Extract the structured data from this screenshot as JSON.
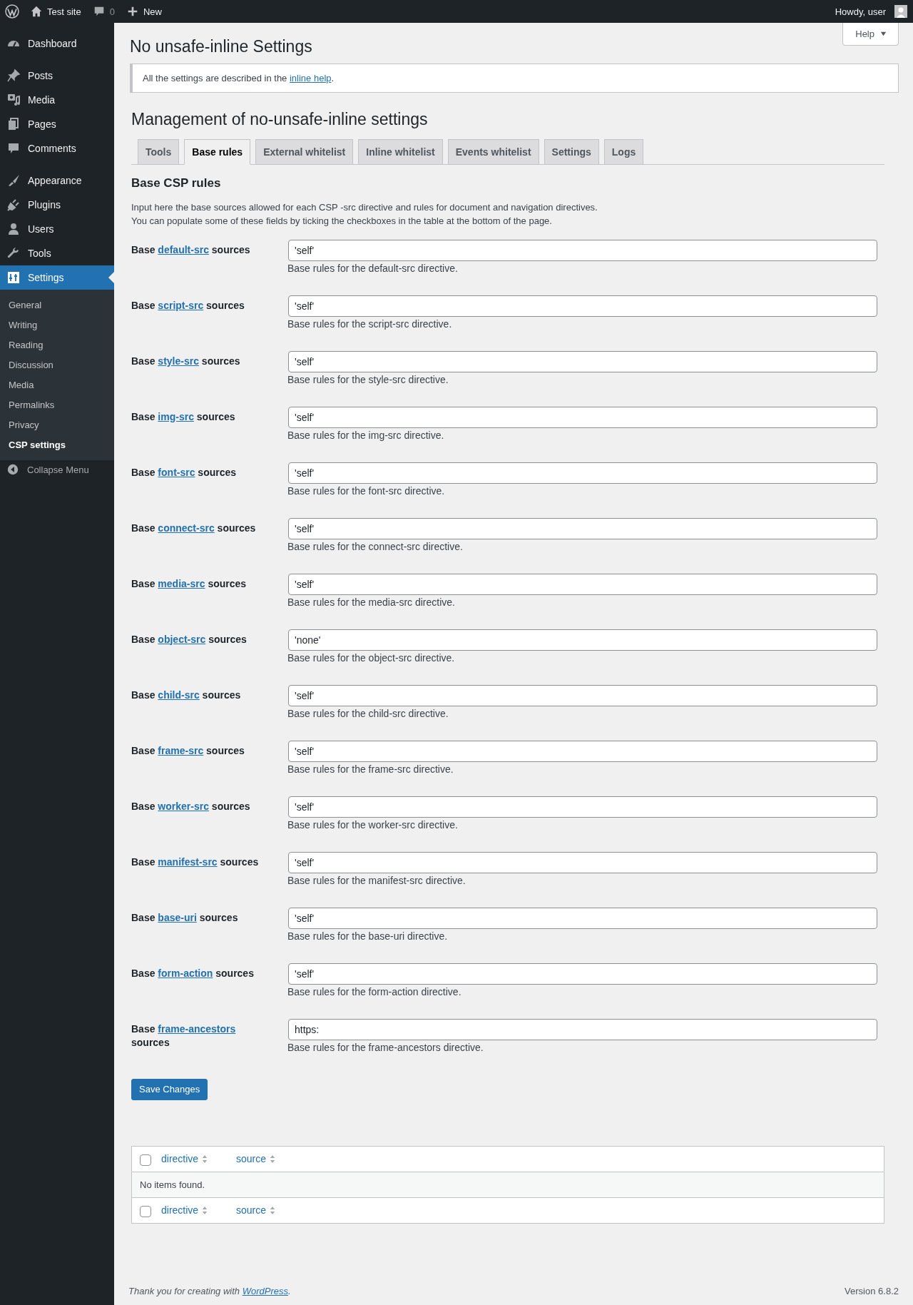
{
  "admin_bar": {
    "site": "Test site",
    "comments": "0",
    "new": "New",
    "greeting": "Howdy, user"
  },
  "menu": [
    {
      "items": [
        {
          "label": "Dashboard",
          "selected": false
        }
      ]
    },
    {
      "items": [
        {
          "label": "Posts",
          "selected": false
        },
        {
          "label": "Media",
          "selected": false
        },
        {
          "label": "Pages",
          "selected": false
        },
        {
          "label": "Comments",
          "selected": false
        }
      ]
    },
    {
      "items": [
        {
          "label": "Appearance",
          "selected": false
        },
        {
          "label": "Plugins",
          "selected": false
        },
        {
          "label": "Users",
          "selected": false
        },
        {
          "label": "Tools",
          "selected": false
        },
        {
          "label": "Settings",
          "selected": true,
          "submenu": [
            {
              "label": "General",
              "selected": false
            },
            {
              "label": "Writing",
              "selected": false
            },
            {
              "label": "Reading",
              "selected": false
            },
            {
              "label": "Discussion",
              "selected": false
            },
            {
              "label": "Media",
              "selected": false
            },
            {
              "label": "Permalinks",
              "selected": false
            },
            {
              "label": "Privacy",
              "selected": false
            },
            {
              "label": "CSP settings",
              "selected": true
            }
          ]
        }
      ]
    }
  ],
  "collapse_menu": "Collapse Menu",
  "help_button": "Help",
  "page_title": "No unsafe-inline Settings",
  "notice": {
    "text": "All the settings are described in the",
    "link": "inline help",
    "after": "."
  },
  "section_title": "Management of no-unsafe-inline settings",
  "tabs": [
    {
      "label": "Tools",
      "selected": false
    },
    {
      "label": "Base rules",
      "selected": true
    },
    {
      "label": "External whitelist",
      "selected": false
    },
    {
      "label": "Inline whitelist",
      "selected": false
    },
    {
      "label": "Events whitelist",
      "selected": false
    },
    {
      "label": "Settings",
      "selected": false
    },
    {
      "label": "Logs",
      "selected": false
    }
  ],
  "subsection_title": "Base CSP rules",
  "intro": [
    "Input here the base sources allowed for each CSP -src directive and rules for document and navigation directives.",
    "You can populate some of these fields by ticking the checkboxes in the table at the bottom of the page."
  ],
  "fields": [
    {
      "before": "Base",
      "link": "default-src",
      "after": "sources",
      "value": "'self'",
      "description": "Base rules for the default-src directive."
    },
    {
      "before": "Base",
      "link": "script-src",
      "after": "sources",
      "value": "'self'",
      "description": "Base rules for the script-src directive."
    },
    {
      "before": "Base",
      "link": "style-src",
      "after": "sources",
      "value": "'self'",
      "description": "Base rules for the style-src directive."
    },
    {
      "before": "Base",
      "link": "img-src",
      "after": "sources",
      "value": "'self'",
      "description": "Base rules for the img-src directive."
    },
    {
      "before": "Base",
      "link": "font-src",
      "after": "sources",
      "value": "'self'",
      "description": "Base rules for the font-src directive."
    },
    {
      "before": "Base",
      "link": "connect-src",
      "after": "sources",
      "value": "'self'",
      "description": "Base rules for the connect-src directive."
    },
    {
      "before": "Base",
      "link": "media-src",
      "after": "sources",
      "value": "'self'",
      "description": "Base rules for the media-src directive."
    },
    {
      "before": "Base",
      "link": "object-src",
      "after": "sources",
      "value": "'none'",
      "description": "Base rules for the object-src directive."
    },
    {
      "before": "Base",
      "link": "child-src",
      "after": "sources",
      "value": "'self'",
      "description": "Base rules for the child-src directive."
    },
    {
      "before": "Base",
      "link": "frame-src",
      "after": "sources",
      "value": "'self'",
      "description": "Base rules for the frame-src directive."
    },
    {
      "before": "Base",
      "link": "worker-src",
      "after": "sources",
      "value": "'self'",
      "description": "Base rules for the worker-src directive."
    },
    {
      "before": "Base",
      "link": "manifest-src",
      "after": "sources",
      "value": "'self'",
      "description": "Base rules for the manifest-src directive."
    },
    {
      "before": "Base",
      "link": "base-uri",
      "after": "sources",
      "value": "'self'",
      "description": "Base rules for the base-uri directive."
    },
    {
      "before": "Base",
      "link": "form-action",
      "after": "sources",
      "value": "'self'",
      "description": "Base rules for the form-action directive."
    },
    {
      "before": "Base",
      "link": "frame-ancestors",
      "after": "sources",
      "value": "https:",
      "description": "Base rules for the frame-ancestors directive."
    }
  ],
  "save_button": "Save Changes",
  "table": {
    "header": {
      "checked": false,
      "columns": [
        "directive",
        "source"
      ]
    },
    "empty_message": "No items found.",
    "footer": {
      "checked": false,
      "columns": [
        "directive",
        "source"
      ]
    }
  },
  "footer": {
    "text": "Thank you for creating with",
    "link": "WordPress",
    "after": ".",
    "version": "Version 6.8.2"
  }
}
